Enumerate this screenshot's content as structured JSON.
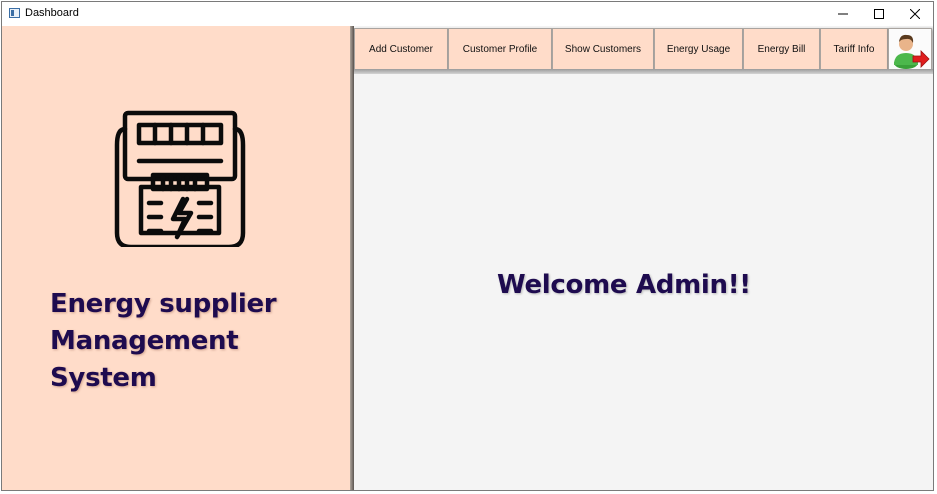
{
  "window": {
    "title": "Dashboard"
  },
  "titlebar_icons": {
    "app": "window-icon",
    "minimize": "minimize-icon",
    "maximize": "maximize-icon",
    "close": "close-icon"
  },
  "sidebar": {
    "icon": "electric-meter-icon",
    "title_lines": [
      "Energy supplier",
      "Management",
      "System"
    ]
  },
  "toolbar": {
    "buttons": [
      {
        "label": "Add Customer"
      },
      {
        "label": "Customer Profile"
      },
      {
        "label": "Show Customers"
      },
      {
        "label": "Energy Usage"
      },
      {
        "label": "Energy Bill"
      },
      {
        "label": "Tariff Info"
      }
    ],
    "logout_icon": "logout-user-icon"
  },
  "main": {
    "welcome": "Welcome Admin!!"
  },
  "colors": {
    "panel": "#ffdcc9",
    "title_text": "#1e0b4f",
    "content_bg": "#f4f4f4"
  }
}
